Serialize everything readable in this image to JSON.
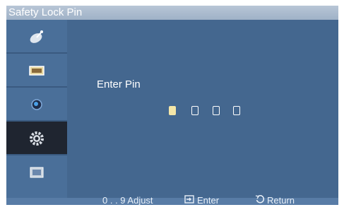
{
  "title": "Safety Lock Pin",
  "pin": {
    "label": "Enter Pin",
    "digits_total": 4,
    "active_index": 0
  },
  "sidebar": {
    "items": [
      {
        "name": "satellite-dish-icon"
      },
      {
        "name": "picture-icon"
      },
      {
        "name": "sound-icon"
      },
      {
        "name": "setup-gear-icon",
        "active": true
      },
      {
        "name": "input-icon"
      }
    ]
  },
  "footer": {
    "adjust": "0 . . 9  Adjust",
    "enter": "Enter",
    "return": "Return"
  },
  "colors": {
    "background": "#44678f",
    "title_bar": "#a9bacd",
    "active_item": "#1f2530",
    "cursor": "#f4e6a8"
  }
}
